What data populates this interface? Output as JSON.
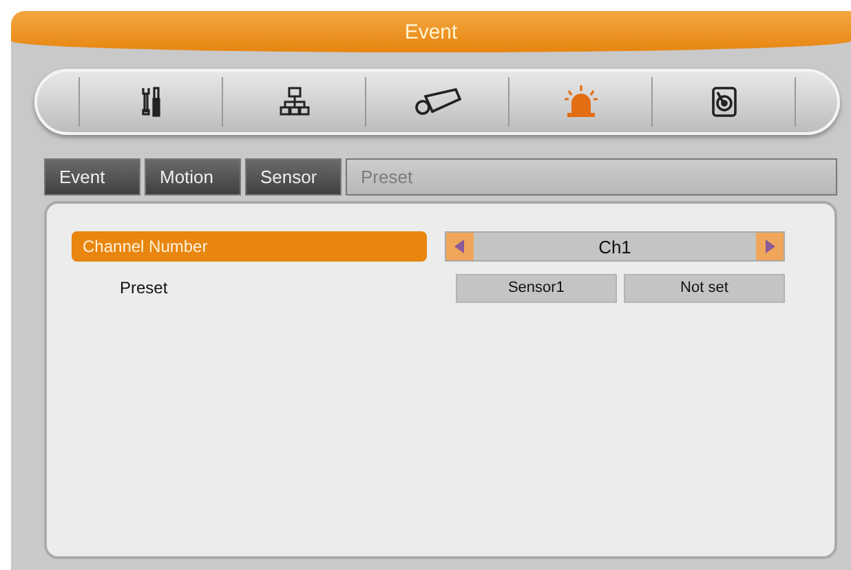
{
  "window": {
    "title": "Event"
  },
  "toolbar": [
    {
      "kind": "tools",
      "selected": false
    },
    {
      "kind": "network",
      "selected": false
    },
    {
      "kind": "camera",
      "selected": false
    },
    {
      "kind": "alarm",
      "selected": true
    },
    {
      "kind": "disk",
      "selected": false
    }
  ],
  "tabs": [
    {
      "label": "Event",
      "selected": false
    },
    {
      "label": "Motion",
      "selected": false
    },
    {
      "label": "Sensor",
      "selected": false
    },
    {
      "label": "Preset",
      "selected": true
    }
  ],
  "settings": {
    "channel": {
      "label": "Channel Number",
      "value": "Ch1"
    },
    "preset": {
      "label": "Preset",
      "values": [
        "Sensor1",
        "Not set"
      ]
    }
  }
}
